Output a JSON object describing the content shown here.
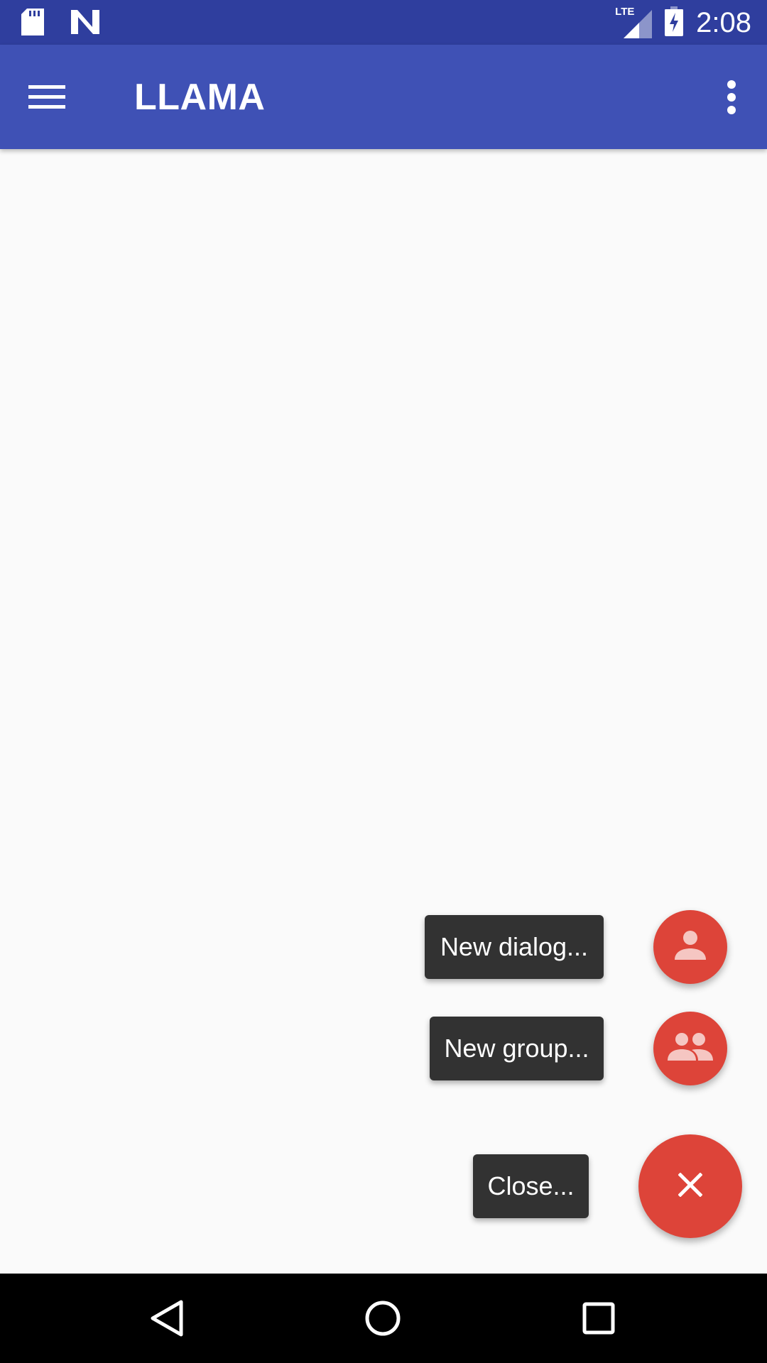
{
  "status_bar": {
    "time": "2:08",
    "network_label": "LTE",
    "icons": [
      "sd-card-icon",
      "n-notification-icon",
      "lte-signal-icon",
      "battery-charging-icon"
    ]
  },
  "app_bar": {
    "title": "LLAMA",
    "icons": [
      "hamburger-menu-icon",
      "overflow-menu-icon"
    ]
  },
  "fab_menu": {
    "items": [
      {
        "label": "New dialog...",
        "icon": "person-icon"
      },
      {
        "label": "New group...",
        "icon": "group-icon"
      },
      {
        "label": "Close...",
        "icon": "close-icon"
      }
    ]
  },
  "colors": {
    "status_bar": "#2f3e9e",
    "app_bar": "#3f51b5",
    "fab": "#dd4439",
    "label_bg": "#323232",
    "background": "#fafafa"
  },
  "nav_bar": {
    "icons": [
      "back-icon",
      "home-icon",
      "recents-icon"
    ]
  }
}
